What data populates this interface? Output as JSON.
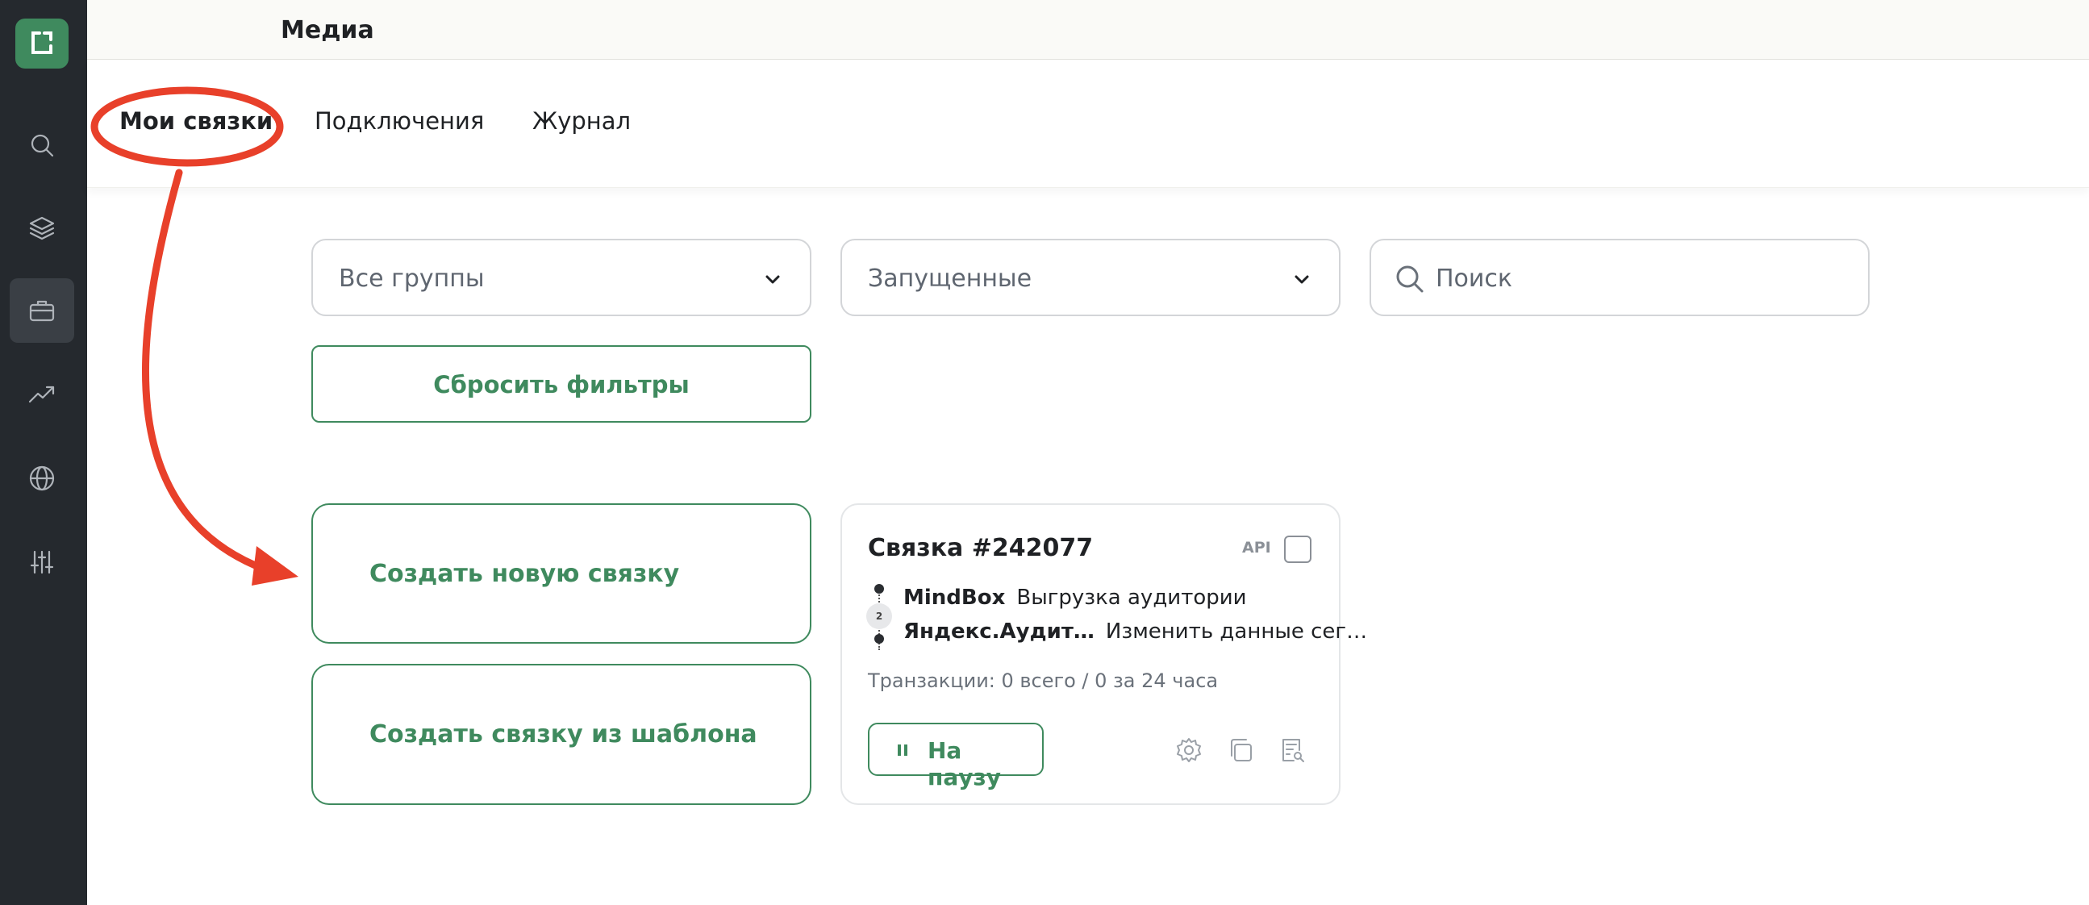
{
  "app": {
    "title": "Медиа",
    "accent": "#3f8a5e",
    "annotation_color": "#e8402a"
  },
  "sidebar": {
    "items": [
      {
        "icon": "search-icon"
      },
      {
        "icon": "layers-icon"
      },
      {
        "icon": "briefcase-icon",
        "active": true
      },
      {
        "icon": "trend-icon"
      },
      {
        "icon": "globe-icon"
      },
      {
        "icon": "sliders-icon"
      }
    ]
  },
  "tabs": [
    "Мои связки",
    "Подключения",
    "Журнал"
  ],
  "filters": {
    "group_select": "Все группы",
    "status_select": "Запущенные",
    "search_placeholder": "Поиск",
    "reset_label": "Сбросить фильтры"
  },
  "create": {
    "new_label": "Создать новую связку",
    "template_label": "Создать связку из шаблона"
  },
  "card": {
    "title": "Связка #242077",
    "badge": "API",
    "steps": [
      {
        "service": "MindBox",
        "action": "Выгрузка аудитории"
      },
      {
        "service": "Яндекс.Аудит…",
        "action": "Изменить данные сег…"
      }
    ],
    "step_number": "2",
    "transactions": "Транзакции: 0 всего / 0 за 24 часа",
    "pause_label": "На паузу",
    "actions": [
      "gear-icon",
      "copy-icon",
      "log-icon"
    ]
  }
}
